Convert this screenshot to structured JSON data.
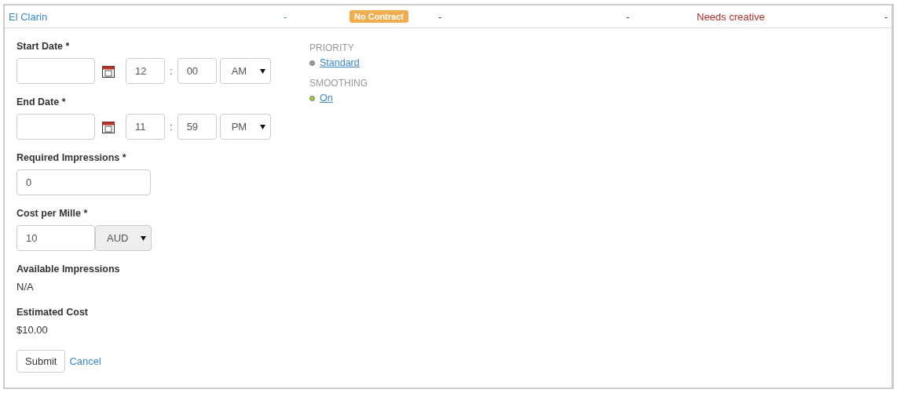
{
  "header_row": {
    "cells": [
      {
        "kind": "link",
        "text": "El Clarin"
      },
      {
        "kind": "link",
        "text": "-"
      },
      {
        "kind": "badge",
        "text": "No Contract"
      },
      {
        "kind": "text",
        "text": "-"
      },
      {
        "kind": "text",
        "text": "-"
      },
      {
        "kind": "status",
        "text": "Needs creative"
      },
      {
        "kind": "text",
        "text": "-"
      }
    ]
  },
  "form": {
    "start_date": {
      "label": "Start Date *",
      "hour": "12",
      "minute": "00",
      "meridiem": "AM"
    },
    "end_date": {
      "label": "End Date *",
      "hour": "11",
      "minute": "59",
      "meridiem": "PM"
    },
    "time_separator": ":",
    "required_impressions": {
      "label": "Required Impressions *",
      "value": "0"
    },
    "cost_per_mille": {
      "label": "Cost per Mille *",
      "value": "10",
      "currency": "AUD"
    },
    "available_impressions": {
      "label": "Available Impressions",
      "value": "N/A"
    },
    "estimated_cost": {
      "label": "Estimated Cost",
      "value": "$10.00"
    },
    "submit": "Submit",
    "cancel": "Cancel"
  },
  "settings": [
    {
      "heading": "PRIORITY",
      "value": "Standard",
      "color": "#9a9a9a"
    },
    {
      "heading": "SMOOTHING",
      "value": "On",
      "color": "#9acd32"
    }
  ]
}
